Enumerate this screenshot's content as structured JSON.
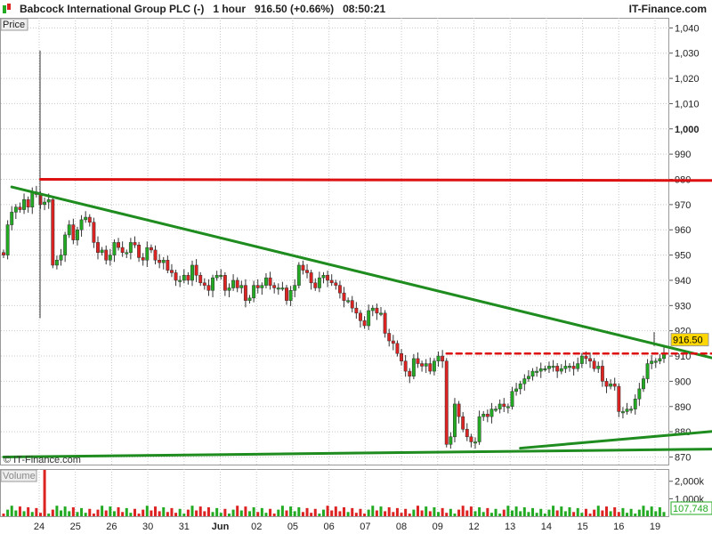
{
  "header": {
    "title": "Babcock International Group PLC (-)   1 hour   916.50 (+0.66%)   08:50:21",
    "brand": "IT-Finance.com",
    "watermark": "© IT-Finance.com"
  },
  "colors": {
    "up": "#22aa22",
    "down": "#dd2222",
    "trendline_green": "#1e8c1e",
    "resistance_red": "#dd1111",
    "price_tag": "#ffd700",
    "grid": "#c8c8c8"
  },
  "chart_data": {
    "type": "candlestick",
    "price_label": "Price",
    "volume_label": "Volume",
    "last_price": "916.50",
    "last_volume": "107,748",
    "price_ticks": [
      "1,040",
      "1,030",
      "1,020",
      "1,010",
      "1,000",
      "990",
      "980",
      "970",
      "960",
      "950",
      "940",
      "930",
      "920",
      "910",
      "900",
      "890",
      "880",
      "870"
    ],
    "price_tick_values": [
      1040,
      1030,
      1020,
      1010,
      1000,
      990,
      980,
      970,
      960,
      950,
      940,
      930,
      920,
      910,
      900,
      890,
      880,
      870
    ],
    "volume_ticks": [
      "2,000k",
      "1,000k"
    ],
    "volume_tick_values": [
      2000000,
      1000000
    ],
    "x_labels": [
      "24",
      "25",
      "26",
      "30",
      "31",
      "Jun",
      "02",
      "05",
      "06",
      "07",
      "08",
      "09",
      "12",
      "13",
      "14",
      "15",
      "16",
      "19"
    ],
    "ylim": [
      867,
      1044
    ],
    "volume_ylim": [
      0,
      2700000
    ],
    "bars_note_omitted": "",
    "trendlines": [
      {
        "name": "downtrend",
        "color": "green",
        "from": {
          "bar": 2,
          "price": 977
        },
        "to": {
          "bar": 186,
          "price": 904
        }
      },
      {
        "name": "resistance",
        "color": "red",
        "from": {
          "bar": 9,
          "price": 980
        },
        "to": {
          "bar": 193,
          "price": 979.5
        }
      },
      {
        "name": "support-dashed",
        "color": "red-dashed",
        "from": {
          "bar": 108,
          "price": 911
        },
        "to": {
          "bar": 193,
          "price": 911
        }
      },
      {
        "name": "lower-support",
        "color": "green",
        "from": {
          "bar": 0,
          "price": 870
        },
        "to": {
          "bar": 193,
          "price": 873.5
        }
      },
      {
        "name": "rising-support",
        "color": "green",
        "from": {
          "bar": 126,
          "price": 873.5
        },
        "to": {
          "bar": 193,
          "price": 883
        }
      },
      {
        "name": "steep-uptrend",
        "color": "green",
        "from": {
          "bar": 176,
          "price": 882
        },
        "to": {
          "bar": 193,
          "price": 914
        }
      }
    ],
    "closes": [
      950,
      962,
      967,
      969,
      968,
      972,
      969,
      975,
      974,
      970,
      971,
      972,
      946,
      948,
      950,
      958,
      962,
      956,
      960,
      964,
      965,
      963,
      955,
      951,
      952,
      948,
      950,
      955,
      953,
      951,
      951,
      955,
      954,
      949,
      948,
      953,
      952,
      948,
      947,
      948,
      944,
      943,
      940,
      940,
      942,
      940,
      946,
      942,
      939,
      938,
      936,
      941,
      942,
      942,
      936,
      937,
      940,
      937,
      938,
      932,
      933,
      938,
      937,
      938,
      941,
      938,
      937,
      937,
      937,
      932,
      936,
      938,
      946,
      944,
      943,
      939,
      937,
      941,
      942,
      940,
      939,
      938,
      935,
      932,
      932,
      929,
      927,
      924,
      922,
      928,
      929,
      927,
      927,
      919,
      916,
      915,
      911,
      908,
      904,
      902,
      909,
      907,
      906,
      907,
      904,
      908,
      910,
      908,
      875,
      878,
      891,
      886,
      881,
      878,
      876,
      876,
      886,
      887,
      886,
      889,
      889,
      891,
      890,
      890,
      896,
      897,
      899,
      901,
      902,
      904,
      904,
      905,
      905,
      906,
      906,
      904,
      905,
      906,
      906,
      905,
      907,
      910,
      909,
      908,
      905,
      906,
      900,
      898,
      899,
      898,
      888,
      888,
      889,
      889,
      893,
      897,
      901,
      907,
      908,
      908,
      909,
      911
    ]
  }
}
